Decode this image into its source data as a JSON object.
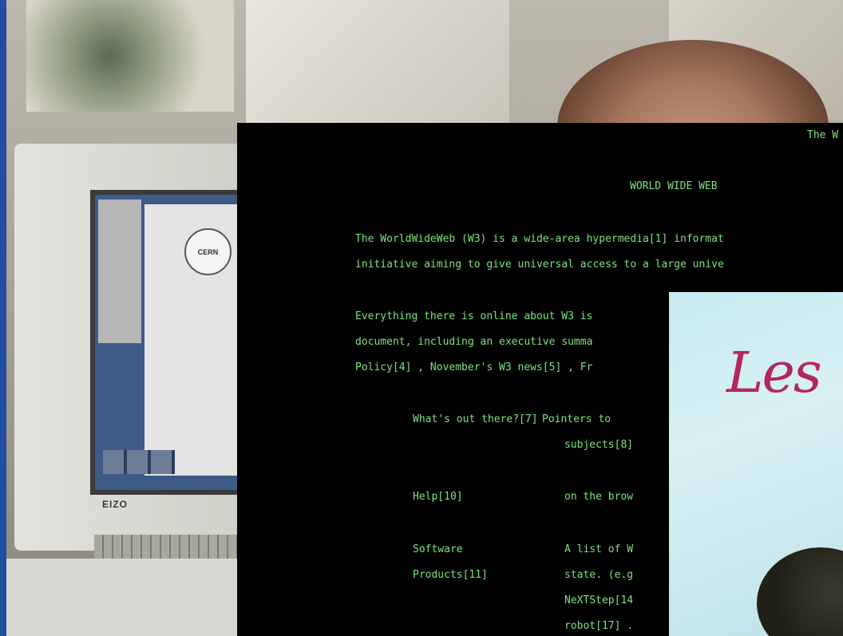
{
  "background": {
    "monitor_brand": "EIZO",
    "screen_logo": "CERN"
  },
  "terminal": {
    "header_right": "The W",
    "heading": "WORLD WIDE WEB",
    "lines": [
      "The WorldWideWeb (W3) is a wide-area hypermedia[1] informat",
      "initiative aiming to give universal access to a large unive",
      "Everything there is online about W3 is",
      "document, including an executive summa",
      "Policy[4] , November's W3 news[5] , Fr"
    ],
    "entries": [
      {
        "label": "What's out there?[7]",
        "desc": [
          "Pointers to",
          "subjects[8]"
        ]
      },
      {
        "label": "Help[10]",
        "desc": [
          "on the brow"
        ]
      },
      {
        "label": "Software",
        "desc": [
          "A list of W"
        ]
      },
      {
        "label": "Products[11]",
        "desc": [
          "state. (e.g"
        ]
      },
      {
        "label": "",
        "desc": [
          "NeXTStep[14"
        ]
      },
      {
        "label": "",
        "desc": [
          "robot[17] ."
        ]
      }
    ]
  },
  "inset": {
    "title": "Les"
  },
  "colors": {
    "terminal_bg": "#010101",
    "terminal_text": "#7ee37e",
    "frame_blue": "#1f4f9e",
    "inset_title": "#b4265c"
  }
}
